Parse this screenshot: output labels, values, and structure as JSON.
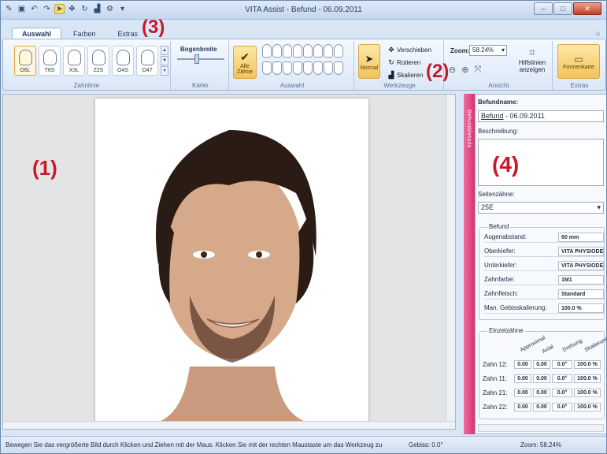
{
  "window": {
    "title": "VITA Assist - Befund - 06.09.2011",
    "min": "–",
    "max": "□",
    "close": "✕"
  },
  "annotations": [
    "(1)",
    "(2)",
    "(3)",
    "(4)"
  ],
  "tabs": [
    "Auswahl",
    "Farben",
    "Extras"
  ],
  "ribbon": {
    "zahnlinie": {
      "items": [
        "O6L",
        "T6S",
        "X3L",
        "Z2S",
        "O4S",
        "O47"
      ],
      "label": "Zahnlinie"
    },
    "kiefer": {
      "slider_label": "Bogenbreite",
      "label": "Kiefer"
    },
    "auswahl": {
      "button": "Alle Zähne",
      "label": "Auswahl"
    },
    "werkzeuge": {
      "normal": "Normal",
      "verschieben": "Verschieben",
      "rotieren": "Rotieren",
      "skalieren": "Skalieren",
      "label": "Werkzeuge"
    },
    "ansicht": {
      "zoom_label": "Zoom:",
      "zoom_value": "58.24%",
      "hilfslinien": "Hilfslinien anzeigen",
      "label": "Ansicht"
    },
    "extras": {
      "formenkarte": "Formenkarte",
      "label": "Extras"
    }
  },
  "panel": {
    "vertical_tab": "Befunddetails",
    "befundname_label": "Befundname:",
    "befundname_word": "Befund",
    "befundname_rest": " - 06.09.2011",
    "beschreibung_label": "Beschreibung:",
    "seitenzaehne_label": "Seitenzähne:",
    "seitenzaehne_value": "25E",
    "befund": {
      "legend": "Befund",
      "rows": [
        {
          "k": "Augenabstand:",
          "v": "60   mm"
        },
        {
          "k": "Oberkiefer:",
          "v": "VITA PHYSIODENS"
        },
        {
          "k": "Unterkiefer:",
          "v": "VITA PHYSIODENS"
        },
        {
          "k": "Zahnfarbe:",
          "v": "1M1"
        },
        {
          "k": "Zahnfleisch:",
          "v": "Standard"
        },
        {
          "k": "Man. Gebisskalierung:",
          "v": "100.0 %"
        }
      ]
    },
    "einzelzaehne": {
      "legend": "Einzelzähne",
      "headers": [
        "Approximal",
        "Axial",
        "Drehung",
        "Skalierung"
      ],
      "rows": [
        {
          "k": "Zahn 12:",
          "c": [
            "0.00",
            "0.00",
            "0.0°",
            "100.0 %"
          ]
        },
        {
          "k": "Zahn 11:",
          "c": [
            "0.00",
            "0.00",
            "0.0°",
            "100.0 %"
          ]
        },
        {
          "k": "Zahn 21:",
          "c": [
            "0.00",
            "0.00",
            "0.0°",
            "100.0 %"
          ]
        },
        {
          "k": "Zahn 22:",
          "c": [
            "0.00",
            "0.00",
            "0.0°",
            "100.0 %"
          ]
        }
      ]
    }
  },
  "status": {
    "hint": "Bewegen Sie das vergrößerte Bild durch Klicken und Ziehen mit der Maus. Klicken Sie mit der rechten Maustaste um das Werkzeug zu",
    "gebiss": "Gebiss: 0.0°",
    "zoom": "Zoom: 58.24%"
  }
}
